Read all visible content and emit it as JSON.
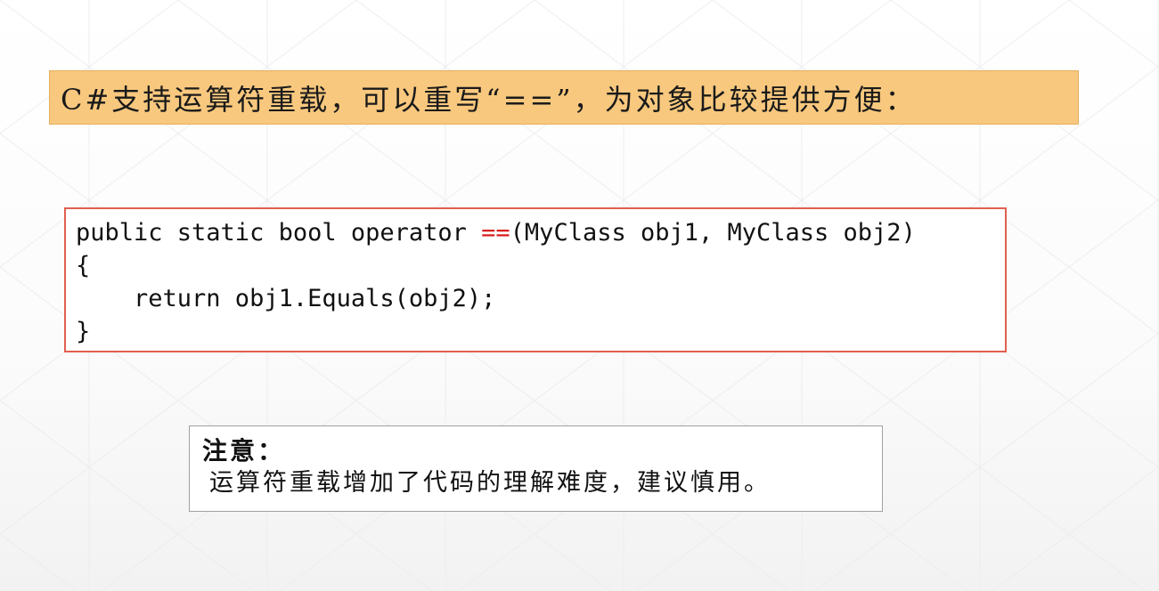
{
  "heading": {
    "text": "C#支持运算符重载，可以重写“==”，为对象比较提供方便："
  },
  "code": {
    "line1_before": "public static bool operator ",
    "line1_operator": "==",
    "line1_after": "(MyClass obj1, MyClass obj2)",
    "line2": "{",
    "line3": "    return obj1.Equals(obj2);",
    "line4": "}"
  },
  "note": {
    "title": "注意：",
    "body": "运算符重载增加了代码的理解难度，建议慎用。"
  },
  "colors": {
    "title_background": "#f8c87e",
    "code_border": "#e0604f",
    "operator_highlight": "#d81e1e",
    "note_border": "#a0a0a0"
  }
}
